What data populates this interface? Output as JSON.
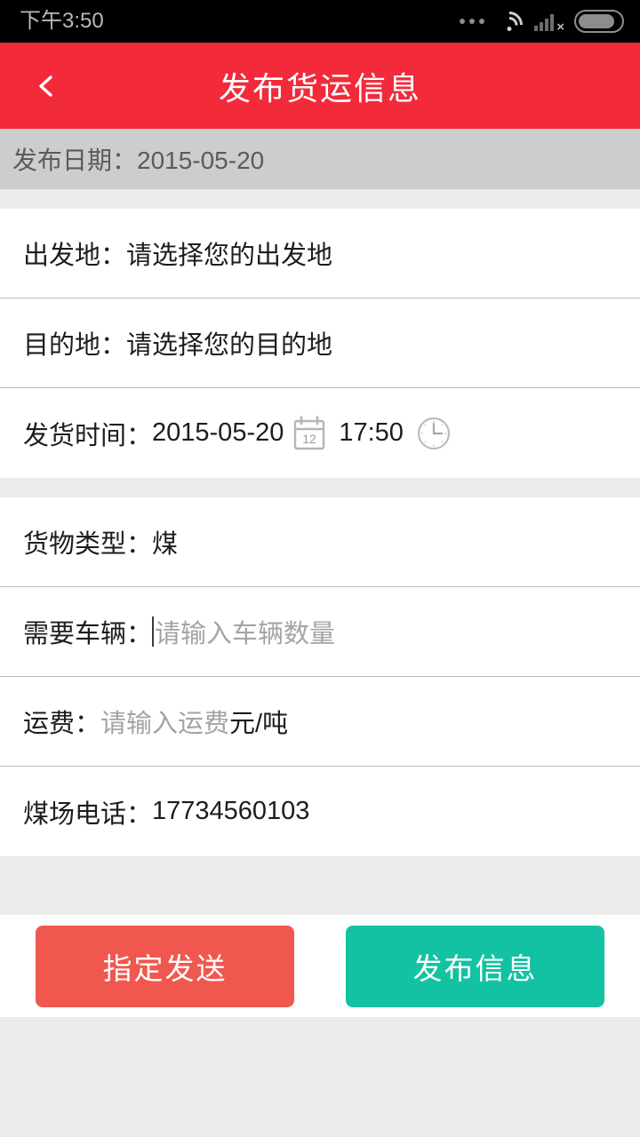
{
  "status_bar": {
    "time": "下午3:50",
    "icons": [
      "more-dots-icon",
      "wifi-icon",
      "signal-no-service-icon",
      "battery-icon"
    ]
  },
  "app_bar": {
    "back_icon": "chevron-left-icon",
    "title": "发布货运信息",
    "background_color": "#f22a3a"
  },
  "date_bar": {
    "text": "发布日期：2015-05-20"
  },
  "form": {
    "origin": {
      "label": "出发地：",
      "placeholder": "请选择您的出发地"
    },
    "destination": {
      "label": "目的地：",
      "placeholder": "请选择您的目的地"
    },
    "ship_time": {
      "label": "发货时间：",
      "date_value": "2015-05-20",
      "calendar_icon_day": "12",
      "time_value": "17:50",
      "calendar_icon": "calendar-icon",
      "clock_icon": "clock-icon"
    },
    "cargo_type": {
      "label": "货物类型：",
      "value": "煤"
    },
    "vehicles": {
      "label": "需要车辆：",
      "placeholder": "请输入车辆数量",
      "value": "",
      "focused": true
    },
    "freight": {
      "label": "运费：",
      "placeholder": "请输入运费",
      "value": "",
      "unit": "元/吨"
    },
    "phone": {
      "label": "煤场电话：",
      "value": "17734560103"
    }
  },
  "actions": {
    "designate_send": {
      "label": "指定发送",
      "color": "#f0584f"
    },
    "publish_info": {
      "label": "发布信息",
      "color": "#13c2a2"
    }
  }
}
